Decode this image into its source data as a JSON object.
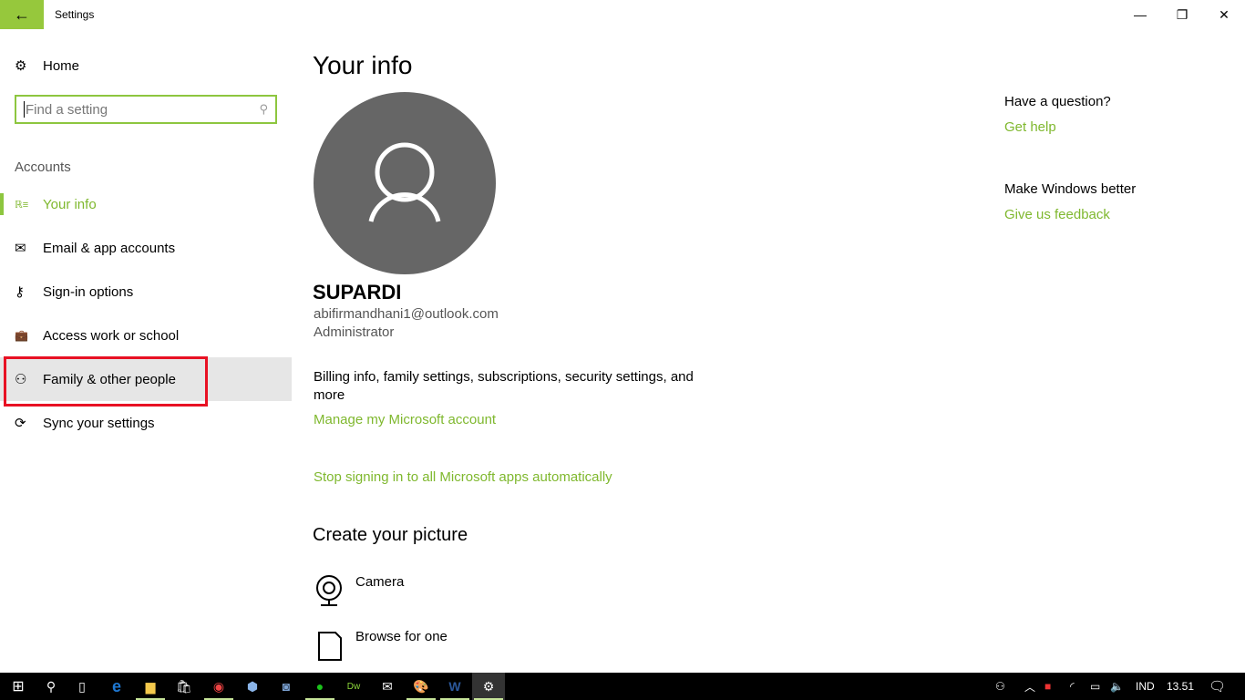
{
  "window": {
    "title": "Settings",
    "back_icon": "←",
    "min": "—",
    "max": "❐",
    "close": "✕"
  },
  "sidebar": {
    "home": "Home",
    "search_placeholder": "Find a setting",
    "section": "Accounts",
    "items": [
      {
        "label": "Your info",
        "icon": "ℝ≡"
      },
      {
        "label": "Email & app accounts",
        "icon": "✉"
      },
      {
        "label": "Sign-in options",
        "icon": "⚷"
      },
      {
        "label": "Access work or school",
        "icon": "💼"
      },
      {
        "label": "Family & other people",
        "icon": "⚇"
      },
      {
        "label": "Sync your settings",
        "icon": "⟳"
      }
    ]
  },
  "main": {
    "title": "Your info",
    "name": "SUPARDI",
    "email": "abifirmandhani1@outlook.com",
    "role": "Administrator",
    "billing": "Billing info, family settings, subscriptions, security settings, and more",
    "manage_link": "Manage my Microsoft account",
    "stop_link": "Stop signing in to all Microsoft apps automatically",
    "picture_title": "Create your picture",
    "camera": "Camera",
    "browse": "Browse for one"
  },
  "aside": {
    "question": "Have a question?",
    "help": "Get help",
    "better": "Make Windows better",
    "feedback": "Give us feedback"
  },
  "taskbar": {
    "lang": "IND",
    "time": "13.51"
  },
  "colors": {
    "accent": "#96c83c",
    "link": "#7fb82e",
    "highlight": "#e81123"
  }
}
